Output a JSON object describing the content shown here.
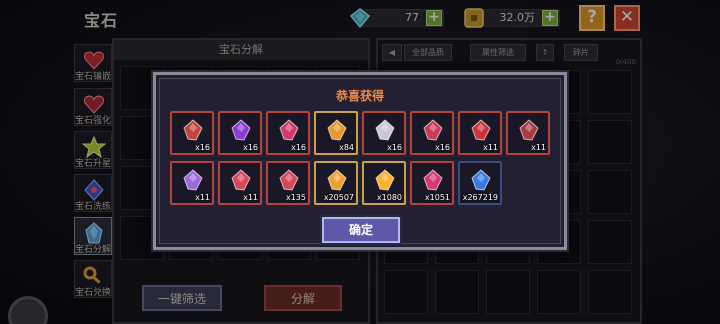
{
  "header": {
    "title": "宝石",
    "gems": "77",
    "gold": "32.0万",
    "help_label": "?",
    "close_label": "✕"
  },
  "nav": {
    "items": [
      {
        "label": "宝石镶嵌",
        "icon": "heart-gem-icon"
      },
      {
        "label": "宝石强化",
        "icon": "heart-gem-icon"
      },
      {
        "label": "宝石升星",
        "icon": "star-gem-icon"
      },
      {
        "label": "宝石洗练",
        "icon": "blue-gem-icon"
      },
      {
        "label": "宝石分解",
        "icon": "crystal-gem-icon"
      },
      {
        "label": "宝石兑换",
        "icon": "key-icon"
      }
    ]
  },
  "left_panel": {
    "title": "宝石分解",
    "filter_label": "一键筛选",
    "decompose_label": "分解"
  },
  "right_panel": {
    "tabs": [
      "全部品质",
      "属性筛选",
      "↑",
      "碎片"
    ],
    "count": "0/400"
  },
  "modal": {
    "title": "恭喜获得",
    "confirm_label": "确定",
    "rewards": [
      {
        "qty": "x16",
        "color": "#c3443a",
        "frame": "red"
      },
      {
        "qty": "x16",
        "color": "#8a3ad6",
        "frame": "red"
      },
      {
        "qty": "x16",
        "color": "#d23a6a",
        "frame": "red"
      },
      {
        "qty": "x84",
        "color": "#e39a2a",
        "frame": "gold"
      },
      {
        "qty": "x16",
        "color": "#c8c8d8",
        "frame": "red"
      },
      {
        "qty": "x16",
        "color": "#c83a58",
        "frame": "red"
      },
      {
        "qty": "x11",
        "color": "#c8343a",
        "frame": "red"
      },
      {
        "qty": "x11",
        "color": "#a83a40",
        "frame": "red"
      },
      {
        "qty": "x11",
        "color": "#9d6ad9",
        "frame": "red"
      },
      {
        "qty": "x11",
        "color": "#d6485a",
        "frame": "red"
      },
      {
        "qty": "x135",
        "color": "#d64858",
        "frame": "red"
      },
      {
        "qty": "x20507",
        "color": "#f0a030",
        "frame": "gold"
      },
      {
        "qty": "x1080",
        "color": "#ffb02a",
        "frame": "gold"
      },
      {
        "qty": "x1051",
        "color": "#d63a6e",
        "frame": "red"
      },
      {
        "qty": "x267219",
        "color": "#3a7ae0",
        "frame": "blue"
      }
    ]
  }
}
